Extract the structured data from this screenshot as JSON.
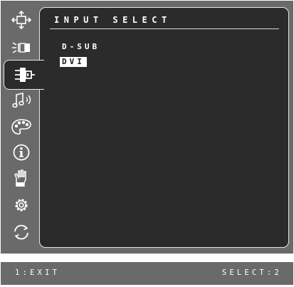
{
  "menu": {
    "title": "INPUT SELECT",
    "options": [
      {
        "label": "D-SUB",
        "selected": false
      },
      {
        "label": "DVI",
        "selected": true
      }
    ]
  },
  "sidebar": {
    "icons": [
      {
        "icon": "position-arrows-icon",
        "active": false
      },
      {
        "icon": "brightness-icon",
        "active": false
      },
      {
        "icon": "input-connector-icon",
        "active": true
      },
      {
        "icon": "audio-note-icon",
        "active": false
      },
      {
        "icon": "color-palette-icon",
        "active": false
      },
      {
        "icon": "information-icon",
        "active": false
      },
      {
        "icon": "manual-adjust-hand-icon",
        "active": false
      },
      {
        "icon": "setup-gear-icon",
        "active": false
      },
      {
        "icon": "recall-arrows-icon",
        "active": false
      }
    ]
  },
  "status": {
    "exit_hint": "1:EXIT",
    "select_hint": "SELECT:2"
  },
  "colors": {
    "frame": "#6a6a6a",
    "panel": "#2b2b2b",
    "text": "#ffffff",
    "highlight": "#ffffff"
  }
}
